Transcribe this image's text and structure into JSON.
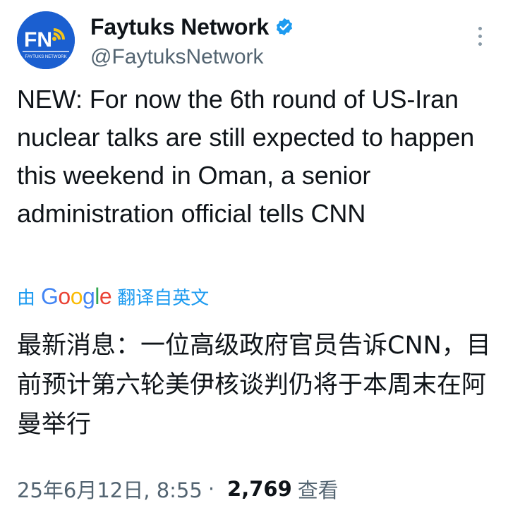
{
  "author": {
    "display_name": "Faytuks Network",
    "handle": "@FaytuksNetwork",
    "avatar_text": "FN",
    "avatar_subtext": "FAYTUKS NETWORK"
  },
  "tweet": {
    "text": "NEW: For now the 6th round of US-Iran nuclear talks are still expected to happen this weekend in Oman, a senior administration official tells CNN"
  },
  "translation": {
    "prefix": "由",
    "provider": "Google",
    "suffix": "翻译自英文",
    "text": "最新消息：一位高级政府官员告诉CNN，目前预计第六轮美伊核谈判仍将于本周末在阿曼举行"
  },
  "meta": {
    "timestamp": "25年6月12日, 8:55",
    "separator": "·",
    "views_count": "2,769",
    "views_label": "查看"
  },
  "colors": {
    "link": "#1d9bf0",
    "secondary_text": "#536471",
    "avatar_bg": "#1b5fd0",
    "verified": "#1d9bf0"
  },
  "icons": {
    "verified": "verified-badge-icon",
    "more": "more-options-icon"
  }
}
